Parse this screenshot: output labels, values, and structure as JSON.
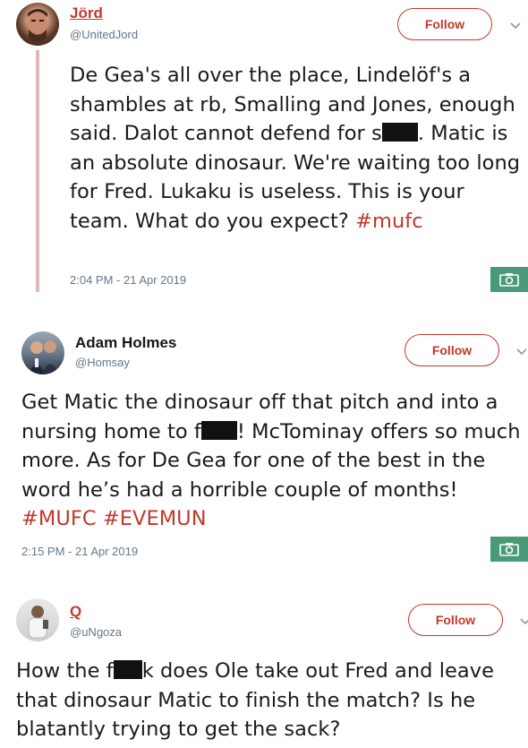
{
  "tweets": [
    {
      "name": "Jörd",
      "handle": "@UnitedJord",
      "follow_label": "Follow",
      "text_before": "De Gea's all over the place, Lindelöf's a shambles at rb, Smalling and Jones, enough said. Dalot cannot defend for s",
      "text_after": ". Matic is an absolute dinosaur. We're waiting too long for Fred. Lukaku is useless. This  is your team. What do you expect? ",
      "hashtags": [
        "#mufc"
      ],
      "timestamp": "2:04 PM - 21 Apr 2019",
      "name_color": "#c0392b"
    },
    {
      "name": "Adam Holmes",
      "handle": "@Homsay",
      "follow_label": "Follow",
      "text_before": "Get Matic the dinosaur off that pitch and into a nursing home to f",
      "text_after": "! McTominay offers so much more. As for De Gea for one of the best in the word he’s had a horrible couple of months! ",
      "hashtags": [
        "#MUFC",
        "#EVEMUN"
      ],
      "timestamp": "2:15 PM - 21 Apr 2019",
      "name_color": "#14171a"
    },
    {
      "name": "Q",
      "handle": "@uNgoza",
      "follow_label": "Follow",
      "text_before": "How the f",
      "text_after": "k does Ole take out Fred and leave that dinosaur Matic to finish the match? Is he blatantly trying to get the sack?",
      "name_color": "#c0392b"
    }
  ],
  "icons": {
    "camera": "camera-icon",
    "chevron": "chevron-down-icon"
  },
  "colors": {
    "accent": "#c0392b",
    "camera_bg": "#4a9a7a",
    "thread_line": "#e6b7b7"
  }
}
